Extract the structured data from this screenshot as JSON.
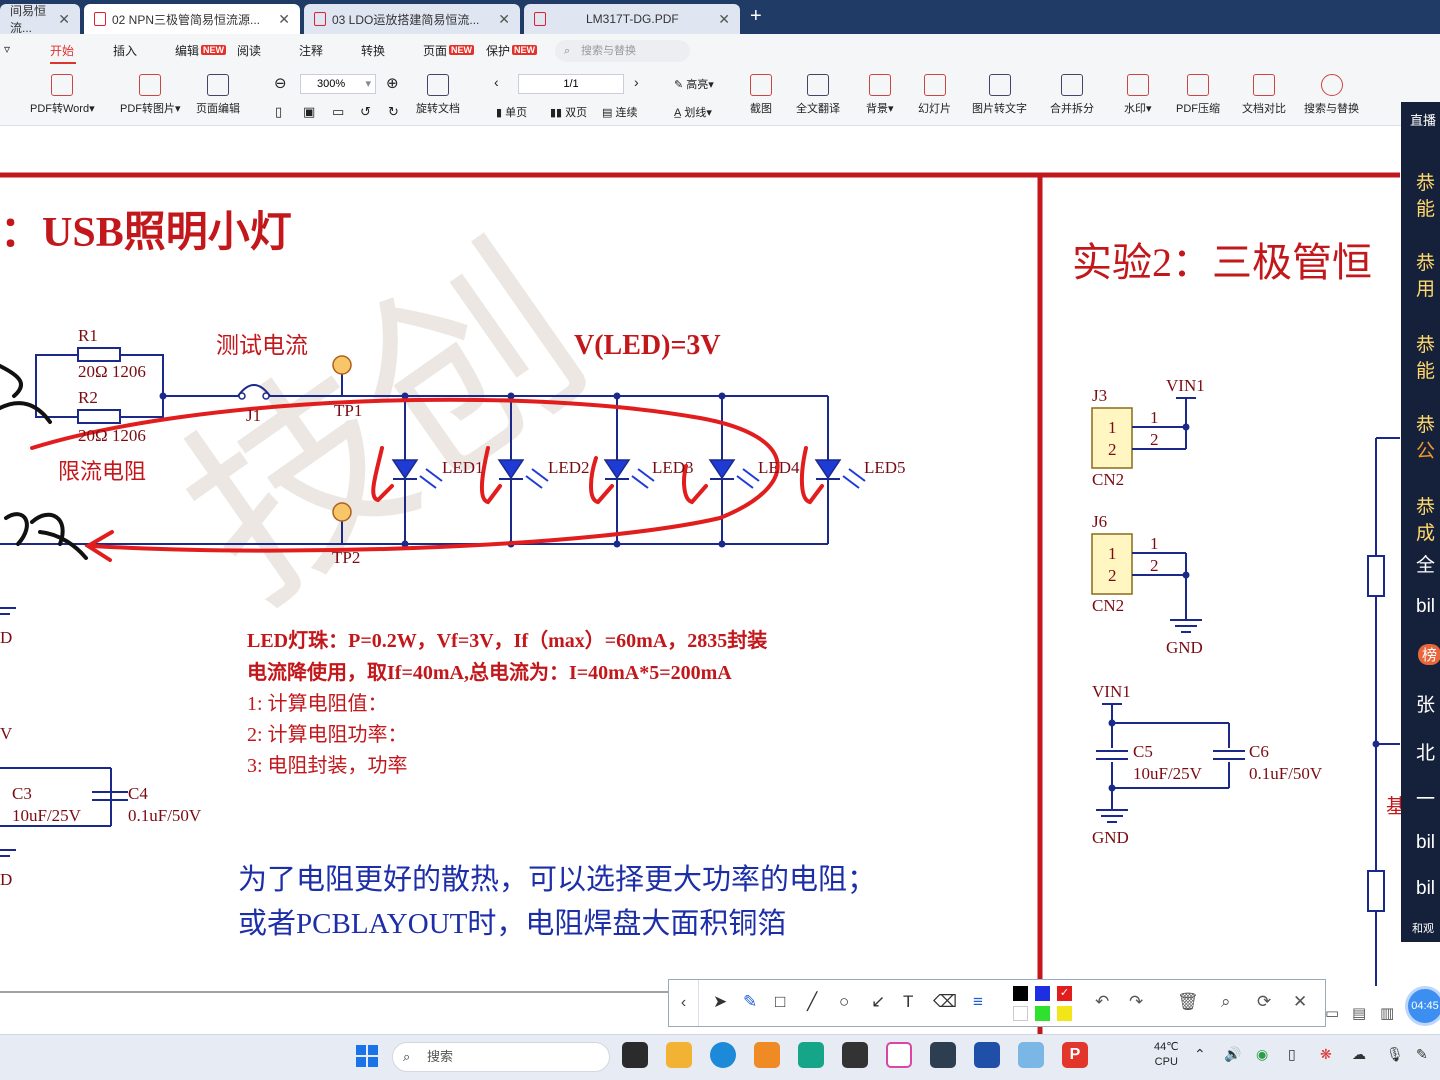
{
  "tabs": [
    {
      "label": "间易恒流..."
    },
    {
      "label": "02 NPN三极管简易恒流源..."
    },
    {
      "label": "03 LDO运放搭建简易恒流..."
    },
    {
      "label": "LM317T-DG.PDF"
    }
  ],
  "menu": {
    "start": "开始",
    "insert": "插入",
    "edit": "编辑",
    "read": "阅读",
    "annotate": "注释",
    "convert": "转换",
    "page": "页面",
    "protect": "保护",
    "new_badge": "NEW",
    "search_placeholder": "搜索与替换"
  },
  "toolbar": {
    "pdf_to_word": "PDF转Word▾",
    "pdf_to_image": "PDF转图片▾",
    "page_edit": "页面编辑",
    "zoom": "300%",
    "rotate": "旋转文档",
    "page": "1/1",
    "single": "单页",
    "double": "双页",
    "continuous": "连续",
    "highlight": "高亮▾",
    "underline": "划线▾",
    "screenshot": "截图",
    "translate": "全文翻译",
    "background": "背景▾",
    "slideshow": "幻灯片",
    "image_to_text": "图片转文字",
    "merge_split": "合并拆分",
    "watermark": "水印▾",
    "pdf_compress": "PDF压缩",
    "compare": "文档对比",
    "search_replace": "搜索与替换"
  },
  "doc": {
    "title_left": "：USB照明小灯",
    "title_right": "实验2：三极管恒",
    "test_current": "测试电流",
    "v_led": "V(LED)=3V",
    "r1": "R1",
    "r1_val": "20Ω 1206",
    "r2": "R2",
    "r2_val": "20Ω 1206",
    "limit_r": "限流电阻",
    "j1": "J1",
    "tp1": "TP1",
    "tp2": "TP2",
    "leds": [
      "LED1",
      "LED2",
      "LED3",
      "LED4",
      "LED5"
    ],
    "gnd_partial": "D",
    "v_partial": "V",
    "c3": "C3",
    "c3_val": "10uF/25V",
    "c4": "C4",
    "c4_val": "0.1uF/50V",
    "spec_line1": "LED灯珠：P=0.2W，Vf=3V，If（max）=60mA，2835封装",
    "spec_line2": "电流降使用，取If=40mA,总电流为：I=40mA*5=200mA",
    "step1": "1: 计算电阻值：",
    "step2": "2: 计算电阻功率：",
    "step3": "3: 电阻封装，功率",
    "note1": "为了电阻更好的散热，可以选择更大功率的电阻；",
    "note2": "或者PCBLAYOUT时，电阻焊盘大面积铜箔",
    "j3": "J3",
    "j6": "J6",
    "cn2a": "CN2",
    "cn2b": "CN2",
    "vin1a": "VIN1",
    "vin1b": "VIN1",
    "pin1": "1",
    "pin2": "2",
    "gnd": "GND",
    "c5": "C5",
    "c5_val": "10uF/25V",
    "c6": "C6",
    "c6_val": "0.1uF/50V",
    "right_partial": "基"
  },
  "live": {
    "header": "直播",
    "items": [
      "恭",
      "能",
      "恭",
      "用",
      "恭",
      "能",
      "恭",
      "公",
      "恭",
      "成",
      "全",
      "bil",
      "榜",
      "张",
      "北",
      "一",
      "bil",
      "bil"
    ],
    "footer": "和观",
    "time": "04:45"
  },
  "taskbar": {
    "search": "搜索",
    "temp": "44℃",
    "cpu": "CPU"
  },
  "colors": {
    "accent_red": "#c2171b",
    "ink_red": "#e11d1d",
    "blue_text": "#1d2fa8",
    "tab_bar": "#1f3b66"
  }
}
